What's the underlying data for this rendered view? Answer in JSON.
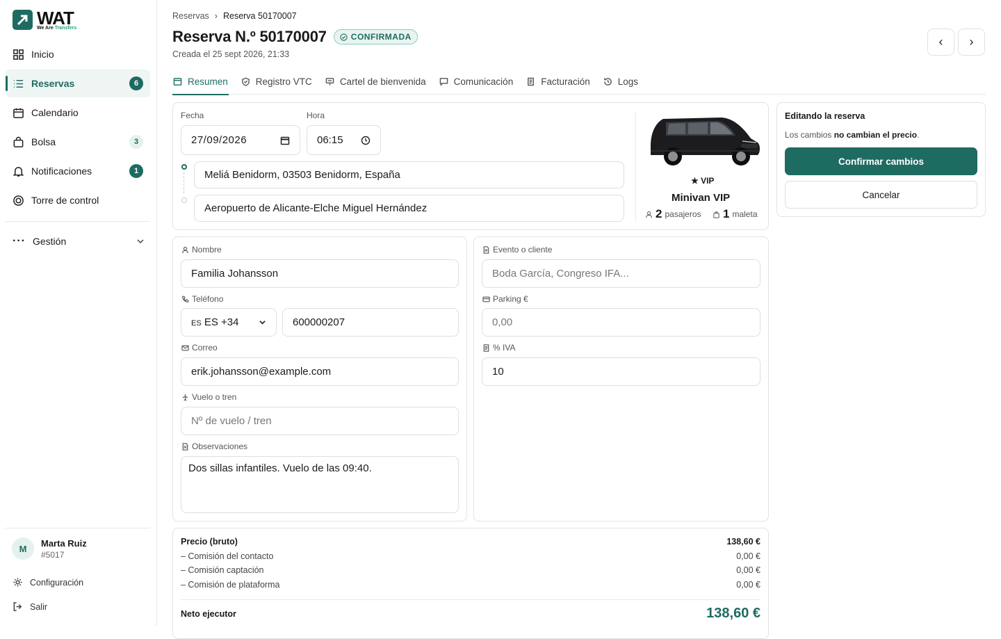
{
  "sidebar": {
    "logo_big": "WAT",
    "logo_small_a": "We Are",
    "logo_small_b": "Transfers",
    "items": [
      {
        "label": "Inicio",
        "icon": "grid-icon"
      },
      {
        "label": "Reservas",
        "icon": "list-icon",
        "badge": "6"
      },
      {
        "label": "Calendario",
        "icon": "calendar-icon"
      },
      {
        "label": "Bolsa",
        "icon": "bag-icon",
        "badge": "3"
      },
      {
        "label": "Notificaciones",
        "icon": "bell-icon",
        "badge": "1"
      },
      {
        "label": "Torre de control",
        "icon": "target-icon"
      }
    ],
    "gestion": "Gestión",
    "user": {
      "initial": "M",
      "name": "Marta Ruiz",
      "id": "#5017"
    },
    "settings": "Configuración",
    "logout": "Salir"
  },
  "header": {
    "breadcrumb_root": "Reservas",
    "breadcrumb_sep": "›",
    "breadcrumb_current": "Reserva 50170007",
    "title": "Reserva N.º 50170007",
    "status": "CONFIRMADA",
    "created": "Creada el 25 sept 2026, 21:33",
    "prev": "‹",
    "next": "›"
  },
  "tabs": [
    "Resumen",
    "Registro VTC",
    "Cartel de bienvenida",
    "Comunicación",
    "Facturación",
    "Logs"
  ],
  "trip": {
    "date_label": "Fecha",
    "date_value": "27/09/2026",
    "time_label": "Hora",
    "time_value": "06:15",
    "origin": "Meliá Benidorm, 03503 Benidorm, España",
    "destination": "Aeropuerto de Alicante-Elche Miguel Hernández"
  },
  "vehicle": {
    "tag": "★ VIP",
    "name": "Minivan VIP",
    "passengers": "2",
    "passengers_label": "pasajeros",
    "bags": "1",
    "bags_label": "maleta"
  },
  "client": {
    "name_label": "Nombre",
    "name_value": "Familia Johansson",
    "phone_label": "Teléfono",
    "phone_prefix": "ES ES +34",
    "phone_value": "600000207",
    "email_label": "Correo",
    "email_value": "erik.johansson@example.com",
    "flight_label": "Vuelo o tren",
    "flight_placeholder": "Nº de vuelo / tren",
    "notes_label": "Observaciones",
    "notes_value": "Dos sillas infantiles. Vuelo de las 09:40."
  },
  "billing": {
    "event_label": "Evento o cliente",
    "event_placeholder": "Boda García, Congreso IFA...",
    "parking_label": "Parking €",
    "parking_placeholder": "0,00",
    "iva_label": "% IVA",
    "iva_value": "10"
  },
  "edit_panel": {
    "title": "Editando la reserva",
    "text_a": "Los cambios ",
    "text_b": "no cambian el precio",
    "text_c": ".",
    "confirm": "Confirmar cambios",
    "cancel": "Cancelar"
  },
  "price": {
    "gross_label": "Precio (bruto)",
    "gross_value": "138,60 €",
    "rows": [
      {
        "label": "– Comisión del contacto",
        "value": "0,00 €"
      },
      {
        "label": "– Comisión captación",
        "value": "0,00 €"
      },
      {
        "label": "– Comisión de plataforma",
        "value": "0,00 €"
      }
    ],
    "net_label": "Neto ejecutor",
    "net_value": "138,60 €"
  },
  "colors": {
    "accent": "#1e6b62",
    "accent_light": "#e4f1ee"
  }
}
